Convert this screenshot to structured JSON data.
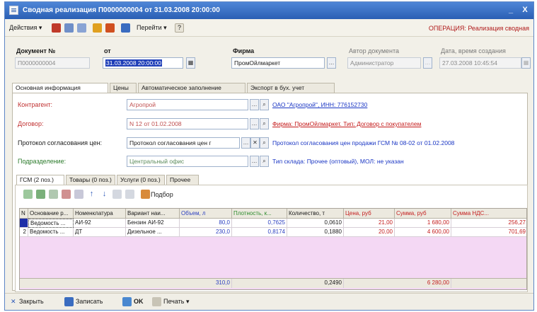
{
  "window": {
    "title": "Сводная реализация П0000000004 от 31.03.2008 20:00:00",
    "controls": {
      "minimize": "_",
      "maximize": "□",
      "close": "X"
    }
  },
  "toolbar": {
    "actions_label": "Действия ▾",
    "goto_label": "Перейти ▾",
    "help_label": "?",
    "operation_label": "ОПЕРАЦИЯ: Реализация сводная"
  },
  "header": {
    "doc_no_label": "Документ №",
    "doc_no_value": "П0000000004",
    "date_label": "от",
    "date_value": "31.03.2008 20:00:00",
    "firm_label": "Фирма",
    "firm_value": "ПромОйлмаркет",
    "author_label": "Автор документа",
    "author_value": "Администратор",
    "created_label": "Дата, время создания",
    "created_value": "27.03.2008 10:45:54"
  },
  "tabs_top": [
    "Основная информация",
    "Цены",
    "Автоматическое заполнение",
    "Экспорт в бух. учет"
  ],
  "main": {
    "contractor_label": "Контрагент:",
    "contractor_value": "Агропрой",
    "contractor_info": "ОАО \"Агропрой\", ИНН: 776152730",
    "contract_label": "Договор:",
    "contract_value": "N 12 от 01.02.2008",
    "contract_info": "Фирма: ПромОйлмаркет. Тип: Договор с покупателем",
    "protocol_label": "Протокол согласования цен:",
    "protocol_value": "Протокол согласования цен г",
    "protocol_info": "Протокол согласования цен продажи ГСМ № 08-02 от 01.02.2008",
    "division_label": "Подразделение:",
    "division_value": "Центральный офис",
    "division_info": "Тип склада: Прочее (оптовый), МОЛ: не указан"
  },
  "tabs_bottom": [
    "ГСМ (2 поз.)",
    "Товары (0 поз.)",
    "Услуги (0 поз.)",
    "Прочее"
  ],
  "table_toolbar": {
    "pick_label": "Подбор"
  },
  "table": {
    "columns": [
      "N",
      "Основание р...",
      "Номенклатура",
      "Вариант наи...",
      "Объем, л",
      "Плотность, к...",
      "Количество, т",
      "Цена, руб",
      "Сумма, руб",
      "Сумма НДС..."
    ],
    "rows": [
      {
        "n": "1",
        "basis": "Ведомость ...",
        "nomenclature": "АИ-92",
        "variant": "Бензин АИ-92",
        "volume": "80,0",
        "density": "0,7625",
        "qty": "0,0610",
        "price": "21,00",
        "sum": "1 680,00",
        "vat": "256,27"
      },
      {
        "n": "2",
        "basis": "Ведомость ...",
        "nomenclature": "ДТ",
        "variant": "Дизельное ...",
        "volume": "230,0",
        "density": "0,8174",
        "qty": "0,1880",
        "price": "20,00",
        "sum": "4 600,00",
        "vat": "701,69"
      }
    ],
    "totals": {
      "volume": "310,0",
      "qty": "0,2490",
      "sum": "6 280,00"
    }
  },
  "bottom_bar": {
    "close_label": "Закрыть",
    "save_label": "Записать",
    "ok_label": "OK",
    "print_label": "Печать ▾"
  },
  "colors": {
    "title_bar": "#2f65bb",
    "operation": "#b01a1a",
    "link": "#1a36c4",
    "grid_bg": "#f4d8f4"
  }
}
